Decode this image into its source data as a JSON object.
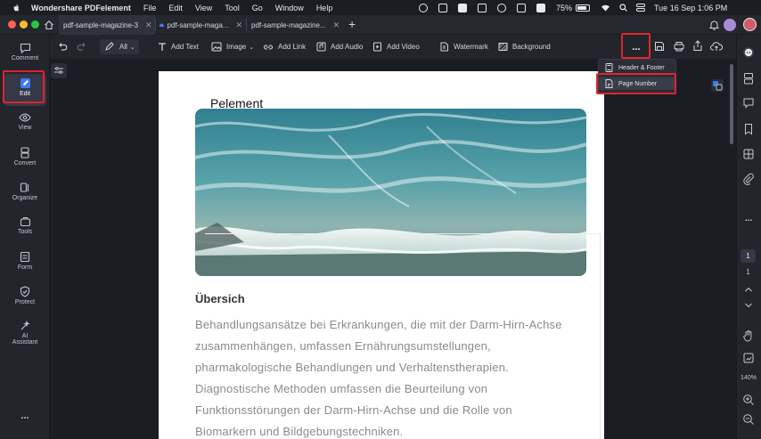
{
  "menubar": {
    "app_name": "Wondershare PDFelement",
    "items": [
      "File",
      "Edit",
      "View",
      "Tool",
      "Go",
      "Window",
      "Help"
    ],
    "battery": "75%",
    "datetime": "Tue 16 Sep  1:06 PM"
  },
  "tabs": [
    {
      "label": "pdf-sample-magazine-3",
      "cloud": false
    },
    {
      "label": "pdf-sample-maga...",
      "cloud": true
    },
    {
      "label": "pdf-sample-magazine..."
    }
  ],
  "sidebar": {
    "items": [
      {
        "label": "Comment",
        "icon": "comment-icon"
      },
      {
        "label": "Edit",
        "icon": "edit-icon"
      },
      {
        "label": "View",
        "icon": "eye-icon"
      },
      {
        "label": "Convert",
        "icon": "convert-icon"
      },
      {
        "label": "Organize",
        "icon": "organize-icon"
      },
      {
        "label": "Tools",
        "icon": "tools-icon"
      },
      {
        "label": "Form",
        "icon": "form-icon"
      },
      {
        "label": "Protect",
        "icon": "shield-icon"
      },
      {
        "label": "AI",
        "label2": "Assistant",
        "icon": "ai-assistant-icon"
      }
    ],
    "more": "..."
  },
  "toolbar": {
    "all_label": "All",
    "add_text": "Add Text",
    "image": "Image",
    "add_link": "Add Link",
    "add_audio": "Add Audio",
    "add_video": "Add Video",
    "watermark": "Watermark",
    "background": "Background",
    "more": "..."
  },
  "dropdown": {
    "header_footer": "Header & Footer",
    "page_number": "Page Number"
  },
  "document": {
    "title": "Pelement",
    "section": "Übersich",
    "lines": [
      "Behandlungsansätze bei Erkrankungen, die mit der Darm-Hirn-Achse",
      "zusammenhängen, umfassen Ernährungsumstellungen,",
      "pharmakologische Behandlungen und Verhaltenstherapien.",
      "Diagnostische Methoden umfassen die Beurteilung von",
      "Funktionsstörungen der Darm-Hirn-Achse und die Rolle von",
      "Biomarkern und Bildgebungstechniken."
    ]
  },
  "rightbar": {
    "page_current": "1",
    "page_total": "1",
    "zoom": "140%"
  },
  "colors": {
    "highlight": "#e0242d",
    "accent": "#3c7bf4"
  }
}
